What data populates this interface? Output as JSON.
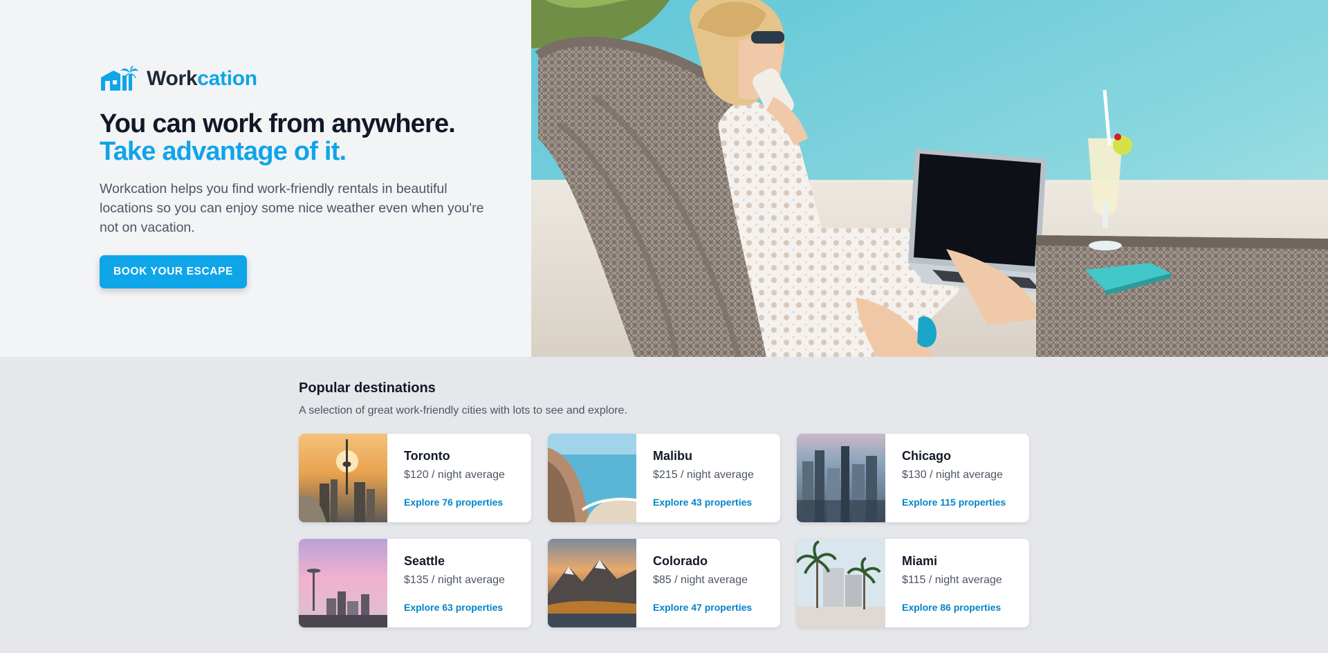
{
  "brand": {
    "name_dark": "Work",
    "name_accent": "cation"
  },
  "hero": {
    "headline_1": "You can work from anywhere.",
    "headline_2": "Take advantage of it.",
    "blurb": "Workcation helps you find work-friendly rentals in beautiful locations so you can enjoy some nice weather even when you're not on vacation.",
    "cta_label": "BOOK YOUR ESCAPE"
  },
  "destinations": {
    "title": "Popular destinations",
    "subtitle": "A selection of great work-friendly cities with lots to see and explore.",
    "items": [
      {
        "city": "Toronto",
        "price": "$120 / night average",
        "explore": "Explore 76 properties"
      },
      {
        "city": "Malibu",
        "price": "$215 / night average",
        "explore": "Explore 43 properties"
      },
      {
        "city": "Chicago",
        "price": "$130 / night average",
        "explore": "Explore 115 properties"
      },
      {
        "city": "Seattle",
        "price": "$135 / night average",
        "explore": "Explore 63 properties"
      },
      {
        "city": "Colorado",
        "price": "$85 / night average",
        "explore": "Explore 47 properties"
      },
      {
        "city": "Miami",
        "price": "$115 / night average",
        "explore": "Explore 86 properties"
      }
    ]
  },
  "colors": {
    "accent": "#0ea5e9",
    "link": "#0284c7",
    "hero_bg": "#f3f4f6",
    "section_bg": "#e5e7eb"
  }
}
